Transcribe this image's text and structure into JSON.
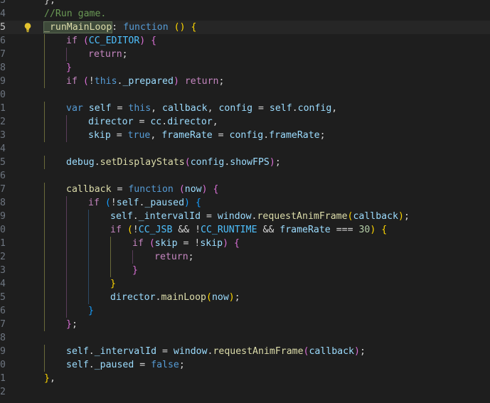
{
  "editor": {
    "background": "#1e1e1e",
    "current_line": 2,
    "lightbulb_line": 2,
    "highlighted_token": "_runMainLoop",
    "lines": [
      {
        "num": "3",
        "indent": 0,
        "tokens": [
          {
            "t": "},",
            "c": "txt"
          }
        ]
      },
      {
        "num": "4",
        "indent": 0,
        "tokens": [
          {
            "t": "//Run game.",
            "c": "cm"
          }
        ]
      },
      {
        "num": "5",
        "indent": 0,
        "tokens": [
          {
            "t": "_runMainLoop",
            "c": "fn"
          },
          {
            "t": ": ",
            "c": "txt"
          },
          {
            "t": "function",
            "c": "kw"
          },
          {
            "t": " ",
            "c": "txt"
          },
          {
            "t": "()",
            "c": "b1"
          },
          {
            "t": " ",
            "c": "txt"
          },
          {
            "t": "{",
            "c": "b1"
          }
        ]
      },
      {
        "num": "6",
        "indent": 1,
        "tokens": [
          {
            "t": "if",
            "c": "ctl"
          },
          {
            "t": " ",
            "c": "txt"
          },
          {
            "t": "(",
            "c": "b2"
          },
          {
            "t": "CC_EDITOR",
            "c": "const"
          },
          {
            "t": ")",
            "c": "b2"
          },
          {
            "t": " ",
            "c": "txt"
          },
          {
            "t": "{",
            "c": "b2"
          }
        ]
      },
      {
        "num": "7",
        "indent": 2,
        "tokens": [
          {
            "t": "return",
            "c": "ctl"
          },
          {
            "t": ";",
            "c": "txt"
          }
        ]
      },
      {
        "num": "8",
        "indent": 1,
        "tokens": [
          {
            "t": "}",
            "c": "b2"
          }
        ]
      },
      {
        "num": "9",
        "indent": 1,
        "tokens": [
          {
            "t": "if",
            "c": "ctl"
          },
          {
            "t": " ",
            "c": "txt"
          },
          {
            "t": "(",
            "c": "b2"
          },
          {
            "t": "!",
            "c": "txt"
          },
          {
            "t": "this",
            "c": "kw"
          },
          {
            "t": ".",
            "c": "txt"
          },
          {
            "t": "_prepared",
            "c": "var"
          },
          {
            "t": ")",
            "c": "b2"
          },
          {
            "t": " ",
            "c": "txt"
          },
          {
            "t": "return",
            "c": "ctl"
          },
          {
            "t": ";",
            "c": "txt"
          }
        ]
      },
      {
        "num": "0",
        "indent": 0,
        "tokens": []
      },
      {
        "num": "1",
        "indent": 1,
        "tokens": [
          {
            "t": "var",
            "c": "kw"
          },
          {
            "t": " ",
            "c": "txt"
          },
          {
            "t": "self",
            "c": "var"
          },
          {
            "t": " = ",
            "c": "txt"
          },
          {
            "t": "this",
            "c": "kw"
          },
          {
            "t": ", ",
            "c": "txt"
          },
          {
            "t": "callback",
            "c": "var"
          },
          {
            "t": ", ",
            "c": "txt"
          },
          {
            "t": "config",
            "c": "var"
          },
          {
            "t": " = ",
            "c": "txt"
          },
          {
            "t": "self",
            "c": "var"
          },
          {
            "t": ".",
            "c": "txt"
          },
          {
            "t": "config",
            "c": "var"
          },
          {
            "t": ",",
            "c": "txt"
          }
        ]
      },
      {
        "num": "2",
        "indent": 2,
        "tokens": [
          {
            "t": "director",
            "c": "var"
          },
          {
            "t": " = ",
            "c": "txt"
          },
          {
            "t": "cc",
            "c": "var"
          },
          {
            "t": ".",
            "c": "txt"
          },
          {
            "t": "director",
            "c": "var"
          },
          {
            "t": ",",
            "c": "txt"
          }
        ]
      },
      {
        "num": "3",
        "indent": 2,
        "tokens": [
          {
            "t": "skip",
            "c": "var"
          },
          {
            "t": " = ",
            "c": "txt"
          },
          {
            "t": "true",
            "c": "kw"
          },
          {
            "t": ", ",
            "c": "txt"
          },
          {
            "t": "frameRate",
            "c": "var"
          },
          {
            "t": " = ",
            "c": "txt"
          },
          {
            "t": "config",
            "c": "var"
          },
          {
            "t": ".",
            "c": "txt"
          },
          {
            "t": "frameRate",
            "c": "var"
          },
          {
            "t": ";",
            "c": "txt"
          }
        ]
      },
      {
        "num": "4",
        "indent": 0,
        "tokens": []
      },
      {
        "num": "5",
        "indent": 1,
        "tokens": [
          {
            "t": "debug",
            "c": "var"
          },
          {
            "t": ".",
            "c": "txt"
          },
          {
            "t": "setDisplayStats",
            "c": "fn"
          },
          {
            "t": "(",
            "c": "b2"
          },
          {
            "t": "config",
            "c": "var"
          },
          {
            "t": ".",
            "c": "txt"
          },
          {
            "t": "showFPS",
            "c": "var"
          },
          {
            "t": ")",
            "c": "b2"
          },
          {
            "t": ";",
            "c": "txt"
          }
        ]
      },
      {
        "num": "6",
        "indent": 0,
        "tokens": []
      },
      {
        "num": "7",
        "indent": 1,
        "tokens": [
          {
            "t": "callback",
            "c": "fn"
          },
          {
            "t": " = ",
            "c": "txt"
          },
          {
            "t": "function",
            "c": "kw"
          },
          {
            "t": " ",
            "c": "txt"
          },
          {
            "t": "(",
            "c": "b2"
          },
          {
            "t": "now",
            "c": "var"
          },
          {
            "t": ")",
            "c": "b2"
          },
          {
            "t": " ",
            "c": "txt"
          },
          {
            "t": "{",
            "c": "b2"
          }
        ]
      },
      {
        "num": "8",
        "indent": 2,
        "tokens": [
          {
            "t": "if",
            "c": "ctl"
          },
          {
            "t": " ",
            "c": "txt"
          },
          {
            "t": "(",
            "c": "b3"
          },
          {
            "t": "!",
            "c": "txt"
          },
          {
            "t": "self",
            "c": "var"
          },
          {
            "t": ".",
            "c": "txt"
          },
          {
            "t": "_paused",
            "c": "var"
          },
          {
            "t": ")",
            "c": "b3"
          },
          {
            "t": " ",
            "c": "txt"
          },
          {
            "t": "{",
            "c": "b3"
          }
        ]
      },
      {
        "num": "9",
        "indent": 3,
        "tokens": [
          {
            "t": "self",
            "c": "var"
          },
          {
            "t": ".",
            "c": "txt"
          },
          {
            "t": "_intervalId",
            "c": "var"
          },
          {
            "t": " = ",
            "c": "txt"
          },
          {
            "t": "window",
            "c": "var"
          },
          {
            "t": ".",
            "c": "txt"
          },
          {
            "t": "requestAnimFrame",
            "c": "fn"
          },
          {
            "t": "(",
            "c": "b1"
          },
          {
            "t": "callback",
            "c": "var"
          },
          {
            "t": ")",
            "c": "b1"
          },
          {
            "t": ";",
            "c": "txt"
          }
        ]
      },
      {
        "num": "0",
        "indent": 3,
        "tokens": [
          {
            "t": "if",
            "c": "ctl"
          },
          {
            "t": " ",
            "c": "txt"
          },
          {
            "t": "(",
            "c": "b1"
          },
          {
            "t": "!",
            "c": "txt"
          },
          {
            "t": "CC_JSB",
            "c": "const"
          },
          {
            "t": " && ",
            "c": "txt"
          },
          {
            "t": "!",
            "c": "txt"
          },
          {
            "t": "CC_RUNTIME",
            "c": "const"
          },
          {
            "t": " && ",
            "c": "txt"
          },
          {
            "t": "frameRate",
            "c": "var"
          },
          {
            "t": " === ",
            "c": "txt"
          },
          {
            "t": "30",
            "c": "num"
          },
          {
            "t": ")",
            "c": "b1"
          },
          {
            "t": " ",
            "c": "txt"
          },
          {
            "t": "{",
            "c": "b1"
          }
        ]
      },
      {
        "num": "1",
        "indent": 4,
        "tokens": [
          {
            "t": "if",
            "c": "ctl"
          },
          {
            "t": " ",
            "c": "txt"
          },
          {
            "t": "(",
            "c": "b2"
          },
          {
            "t": "skip",
            "c": "var"
          },
          {
            "t": " = ",
            "c": "txt"
          },
          {
            "t": "!",
            "c": "txt"
          },
          {
            "t": "skip",
            "c": "var"
          },
          {
            "t": ")",
            "c": "b2"
          },
          {
            "t": " ",
            "c": "txt"
          },
          {
            "t": "{",
            "c": "b2"
          }
        ]
      },
      {
        "num": "2",
        "indent": 5,
        "tokens": [
          {
            "t": "return",
            "c": "ctl"
          },
          {
            "t": ";",
            "c": "txt"
          }
        ]
      },
      {
        "num": "3",
        "indent": 4,
        "tokens": [
          {
            "t": "}",
            "c": "b2"
          }
        ]
      },
      {
        "num": "4",
        "indent": 3,
        "tokens": [
          {
            "t": "}",
            "c": "b1"
          }
        ]
      },
      {
        "num": "5",
        "indent": 3,
        "tokens": [
          {
            "t": "director",
            "c": "var"
          },
          {
            "t": ".",
            "c": "txt"
          },
          {
            "t": "mainLoop",
            "c": "fn"
          },
          {
            "t": "(",
            "c": "b1"
          },
          {
            "t": "now",
            "c": "var"
          },
          {
            "t": ")",
            "c": "b1"
          },
          {
            "t": ";",
            "c": "txt"
          }
        ]
      },
      {
        "num": "6",
        "indent": 2,
        "tokens": [
          {
            "t": "}",
            "c": "b3"
          }
        ]
      },
      {
        "num": "7",
        "indent": 1,
        "tokens": [
          {
            "t": "}",
            "c": "b2"
          },
          {
            "t": ";",
            "c": "txt"
          }
        ]
      },
      {
        "num": "8",
        "indent": 0,
        "tokens": []
      },
      {
        "num": "9",
        "indent": 1,
        "tokens": [
          {
            "t": "self",
            "c": "var"
          },
          {
            "t": ".",
            "c": "txt"
          },
          {
            "t": "_intervalId",
            "c": "var"
          },
          {
            "t": " = ",
            "c": "txt"
          },
          {
            "t": "window",
            "c": "var"
          },
          {
            "t": ".",
            "c": "txt"
          },
          {
            "t": "requestAnimFrame",
            "c": "fn"
          },
          {
            "t": "(",
            "c": "b2"
          },
          {
            "t": "callback",
            "c": "var"
          },
          {
            "t": ")",
            "c": "b2"
          },
          {
            "t": ";",
            "c": "txt"
          }
        ]
      },
      {
        "num": "0",
        "indent": 1,
        "tokens": [
          {
            "t": "self",
            "c": "var"
          },
          {
            "t": ".",
            "c": "txt"
          },
          {
            "t": "_paused",
            "c": "var"
          },
          {
            "t": " = ",
            "c": "txt"
          },
          {
            "t": "false",
            "c": "kw"
          },
          {
            "t": ";",
            "c": "txt"
          }
        ]
      },
      {
        "num": "1",
        "indent": 0,
        "tokens": [
          {
            "t": "}",
            "c": "b1"
          },
          {
            "t": ",",
            "c": "txt"
          }
        ]
      },
      {
        "num": "2",
        "indent": 0,
        "tokens": []
      }
    ]
  }
}
